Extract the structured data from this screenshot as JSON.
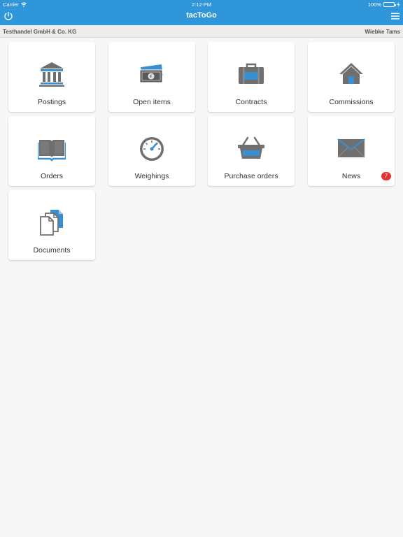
{
  "status": {
    "carrier": "Carrier",
    "time": "2:12 PM",
    "battery": "100%"
  },
  "nav": {
    "title": "tacToGo"
  },
  "subheader": {
    "company": "Testhandel GmbH & Co. KG",
    "user": "Wiebke Tams"
  },
  "tiles": [
    {
      "label": "Postings",
      "icon": "bank-icon"
    },
    {
      "label": "Open items",
      "icon": "money-icon"
    },
    {
      "label": "Contracts",
      "icon": "briefcase-icon"
    },
    {
      "label": "Commissions",
      "icon": "house-icon"
    },
    {
      "label": "Orders",
      "icon": "book-icon"
    },
    {
      "label": "Weighings",
      "icon": "gauge-icon"
    },
    {
      "label": "Purchase orders",
      "icon": "basket-icon"
    },
    {
      "label": "News",
      "icon": "envelope-icon",
      "badge": "7"
    },
    {
      "label": "Documents",
      "icon": "documents-icon"
    }
  ],
  "colors": {
    "accent": "#2f97d9",
    "badge": "#e53333",
    "icon_gray": "#6f6f6f",
    "icon_blue": "#3a8fd0"
  }
}
